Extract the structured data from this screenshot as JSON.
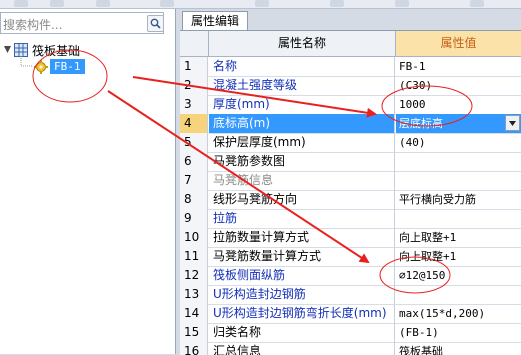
{
  "search": {
    "placeholder": "搜索构件..."
  },
  "tree": {
    "root_label": "筏板基础",
    "child_label": "FB-1"
  },
  "tab": {
    "label": "属性编辑"
  },
  "grid": {
    "header": {
      "name": "属性名称",
      "value": "属性值"
    },
    "rows": [
      {
        "num": "1",
        "name": "名称",
        "value": "FB-1",
        "style": "blue"
      },
      {
        "num": "2",
        "name": "混凝土强度等级",
        "value": "(C30)",
        "style": "blue"
      },
      {
        "num": "3",
        "name": "厚度(mm)",
        "value": "1000",
        "style": "blue"
      },
      {
        "num": "4",
        "name": "底标高(m)",
        "value": "层底标高",
        "style": "blue",
        "selected": true
      },
      {
        "num": "5",
        "name": "保护层厚度(mm)",
        "value": "(40)",
        "style": "normal"
      },
      {
        "num": "6",
        "name": "马凳筋参数图",
        "value": "",
        "style": "normal"
      },
      {
        "num": "7",
        "name": "马凳筋信息",
        "value": "",
        "style": "gray"
      },
      {
        "num": "8",
        "name": "线形马凳筋方向",
        "value": "平行横向受力筋",
        "style": "normal"
      },
      {
        "num": "9",
        "name": "拉筋",
        "value": "",
        "style": "blue"
      },
      {
        "num": "10",
        "name": "拉筋数量计算方式",
        "value": "向上取整+1",
        "style": "normal"
      },
      {
        "num": "11",
        "name": "马凳筋数量计算方式",
        "value": "向上取整+1",
        "style": "normal"
      },
      {
        "num": "12",
        "name": "筏板侧面纵筋",
        "value": "⌀12@150",
        "style": "blue"
      },
      {
        "num": "13",
        "name": "U形构造封边钢筋",
        "value": "",
        "style": "blue"
      },
      {
        "num": "14",
        "name": "U形构造封边钢筋弯折长度(mm)",
        "value": "max(15*d,200)",
        "style": "blue"
      },
      {
        "num": "15",
        "name": "归类名称",
        "value": "(FB-1)",
        "style": "normal"
      },
      {
        "num": "16",
        "name": "汇总信息",
        "value": "筏板基础",
        "style": "normal"
      }
    ]
  },
  "colors": {
    "selection": "#3399ff",
    "annotation": "#e8201e",
    "header_value_bg": "#fbe2a8"
  }
}
